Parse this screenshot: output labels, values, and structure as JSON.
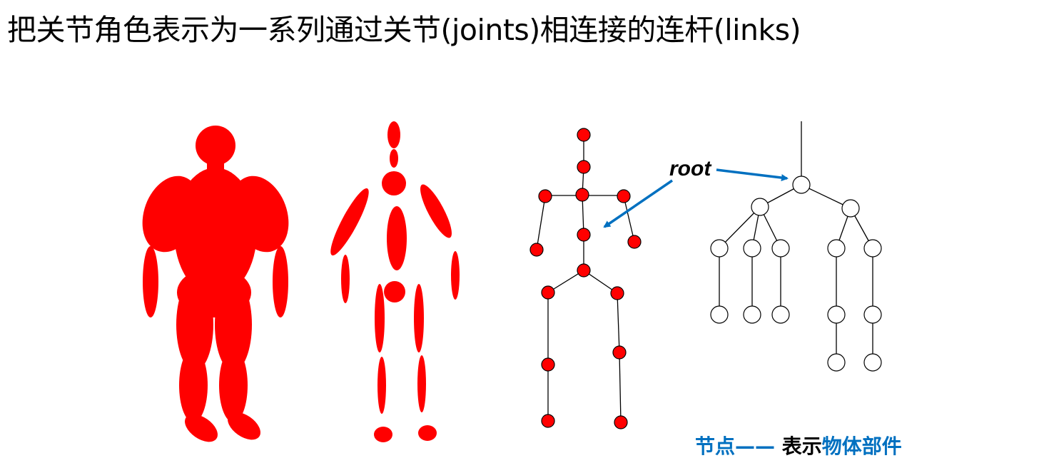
{
  "title": "把关节角色表示为一系列通过关节(joints)相连接的连杆(links)",
  "root_label": "root",
  "caption": {
    "part1": "节点",
    "dash": "—— ",
    "part2": "表示",
    "part3": "物体部件"
  },
  "colors": {
    "body": "#ff0000",
    "arrow": "#0070c0",
    "caption_blue": "#0070c0",
    "line": "#000000",
    "tree_node_fill": "#ffffff"
  },
  "figures": [
    "solid-red-silhouette",
    "segmented-ellipse-body",
    "joint-skeleton",
    "joint-hierarchy-tree"
  ]
}
